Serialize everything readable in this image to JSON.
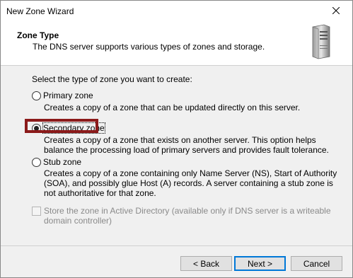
{
  "window": {
    "title": "New Zone Wizard"
  },
  "header": {
    "title": "Zone Type",
    "description": "The DNS server supports various types of zones and storage."
  },
  "content": {
    "prompt": "Select the type of zone you want to create:",
    "options": [
      {
        "label": "Primary zone",
        "description": "Creates a copy of a zone that can be updated directly on this server.",
        "selected": false
      },
      {
        "label": "Secondary zone",
        "description": "Creates a copy of a zone that exists on another server. This option helps balance the processing load of primary servers and provides fault tolerance.",
        "selected": true
      },
      {
        "label": "Stub zone",
        "description": "Creates a copy of a zone containing only Name Server (NS), Start of Authority (SOA), and possibly glue Host (A) records. A server containing a stub zone is not authoritative for that zone.",
        "selected": false
      }
    ],
    "store_in_ad": {
      "label": "Store the zone in Active Directory (available only if DNS server is a writeable domain controller)",
      "checked": false,
      "enabled": false
    }
  },
  "buttons": {
    "back": "< Back",
    "next": "Next >",
    "cancel": "Cancel"
  },
  "colors": {
    "highlight": "#8b1a1a",
    "primary_border": "#0078d7"
  }
}
